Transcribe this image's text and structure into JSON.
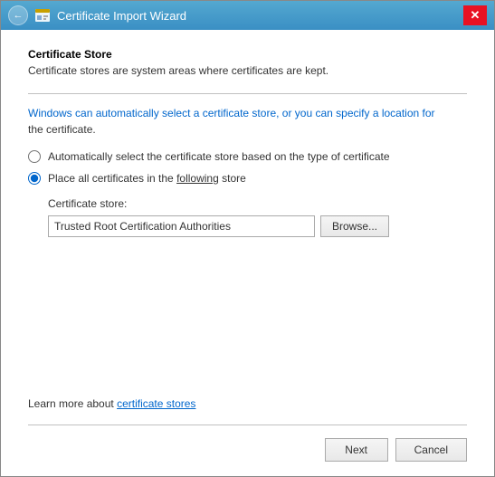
{
  "window": {
    "title": "Certificate Import Wizard",
    "close_label": "✕"
  },
  "content": {
    "section_title": "Certificate Store",
    "section_description": "Certificate stores are system areas where certificates are kept.",
    "info_text_1": "Windows can automatically select a certificate store, or you can specify a location for",
    "info_text_2": "the certificate.",
    "radio_auto_label": "Automatically select the certificate store based on the type of certificate",
    "radio_place_label_1": "Place all certificates in the ",
    "radio_place_label_2": "following",
    "radio_place_label_3": " store",
    "cert_store_label": "Certificate store:",
    "cert_store_value": "Trusted Root Certification Authorities",
    "browse_label": "Browse...",
    "learn_more_prefix": "Learn more about ",
    "learn_more_link": "certificate stores",
    "next_label": "Next",
    "cancel_label": "Cancel"
  }
}
